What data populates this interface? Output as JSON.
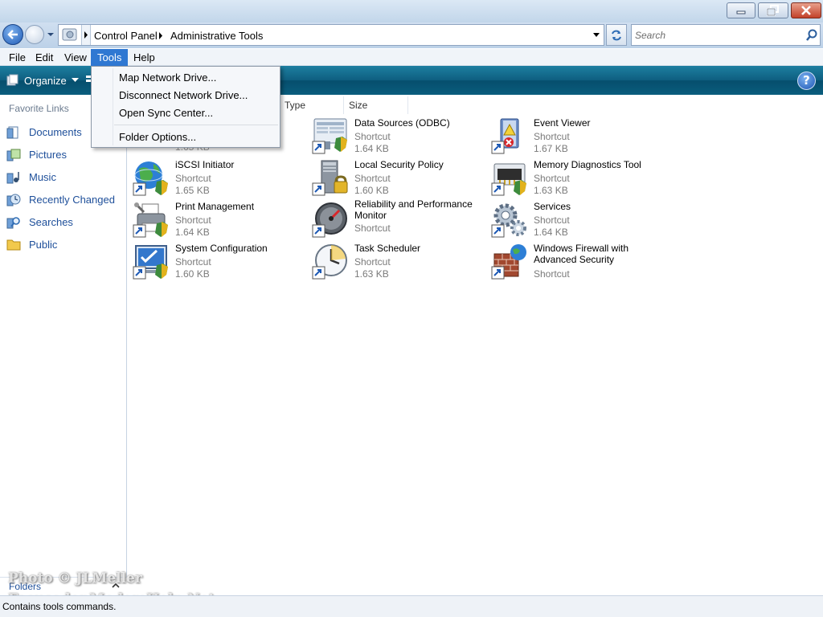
{
  "window": {
    "controls": [
      "minimize",
      "maximize",
      "close"
    ]
  },
  "address": {
    "crumbs": [
      "Control Panel",
      "Administrative Tools"
    ],
    "search_placeholder": "Search"
  },
  "menubar": {
    "items": [
      {
        "label": "File"
      },
      {
        "label": "Edit"
      },
      {
        "label": "View"
      },
      {
        "label": "Tools",
        "active": true
      },
      {
        "label": "Help"
      }
    ]
  },
  "tools_menu": {
    "items": [
      {
        "label": "Map Network Drive..."
      },
      {
        "label": "Disconnect Network Drive..."
      },
      {
        "label": "Open Sync Center..."
      },
      {
        "label": "Folder Options..."
      }
    ]
  },
  "commandbar": {
    "organize_label": "Organize"
  },
  "navpane": {
    "title": "Favorite Links",
    "links": [
      {
        "label": "Documents",
        "icon": "documents-icon"
      },
      {
        "label": "Pictures",
        "icon": "pictures-icon"
      },
      {
        "label": "Music",
        "icon": "music-icon"
      },
      {
        "label": "Recently Changed",
        "icon": "recently-changed-icon"
      },
      {
        "label": "Searches",
        "icon": "searches-icon"
      },
      {
        "label": "Public",
        "icon": "public-folder-icon"
      }
    ],
    "folders_label": "Folders"
  },
  "columns": [
    "Type",
    "Size"
  ],
  "partial_size": "1.65 KB",
  "items": [
    {
      "name": "Data Sources (ODBC)",
      "type": "Shortcut",
      "size": "1.64 KB",
      "icon": "data-sources-icon"
    },
    {
      "name": "Event Viewer",
      "type": "Shortcut",
      "size": "1.67 KB",
      "icon": "event-viewer-icon"
    },
    {
      "name": "iSCSI Initiator",
      "type": "Shortcut",
      "size": "1.65 KB",
      "icon": "iscsi-globe-icon"
    },
    {
      "name": "Local Security Policy",
      "type": "Shortcut",
      "size": "1.60 KB",
      "icon": "security-policy-icon"
    },
    {
      "name": "Memory Diagnostics Tool",
      "type": "Shortcut",
      "size": "1.63 KB",
      "icon": "memory-chip-icon"
    },
    {
      "name": "Print Management",
      "type": "Shortcut",
      "size": "1.64 KB",
      "icon": "printer-icon"
    },
    {
      "name": "Reliability and Performance\nMonitor",
      "type": "Shortcut",
      "size": "",
      "icon": "performance-gauge-icon"
    },
    {
      "name": "Services",
      "type": "Shortcut",
      "size": "1.64 KB",
      "icon": "services-gears-icon"
    },
    {
      "name": "System Configuration",
      "type": "Shortcut",
      "size": "1.60 KB",
      "icon": "system-config-icon"
    },
    {
      "name": "Task Scheduler",
      "type": "Shortcut",
      "size": "1.63 KB",
      "icon": "task-scheduler-clock-icon"
    },
    {
      "name": "Windows Firewall with\nAdvanced Security",
      "type": "Shortcut",
      "size": "",
      "icon": "firewall-icon"
    }
  ],
  "status": {
    "text": "Contains tools commands."
  },
  "watermark": {
    "line1": "Photo © JLMeller",
    "line2": "FocusedonModemHelp.Net"
  },
  "colors": {
    "menu_highlight": "#2f78d2",
    "command_bar": "#0e5e7f",
    "link_blue": "#1e4f9a"
  }
}
